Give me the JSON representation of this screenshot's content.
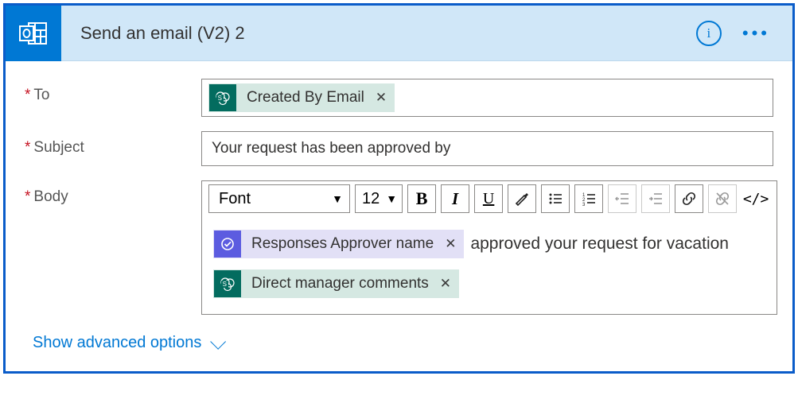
{
  "header": {
    "title": "Send an email (V2) 2",
    "info_label": "i"
  },
  "fields": {
    "to": {
      "label": "To",
      "required_mark": "*",
      "tokens": [
        {
          "label": "Created By Email",
          "source": "sharepoint"
        }
      ]
    },
    "subject": {
      "label": "Subject",
      "required_mark": "*",
      "value": "Your request has been approved by"
    },
    "body": {
      "label": "Body",
      "required_mark": "*",
      "lines": [
        {
          "tokens": [
            {
              "label": "Responses Approver name",
              "source": "approvals"
            }
          ],
          "text_after": "approved your request for vacation"
        },
        {
          "tokens": [
            {
              "label": "Direct manager comments",
              "source": "sharepoint"
            }
          ],
          "text_after": ""
        }
      ]
    }
  },
  "toolbar": {
    "font_label": "Font",
    "size_label": "12",
    "buttons": {
      "bold": "B",
      "italic": "I",
      "underline": "U",
      "code": "</>"
    }
  },
  "footer": {
    "advanced_label": "Show advanced options"
  }
}
